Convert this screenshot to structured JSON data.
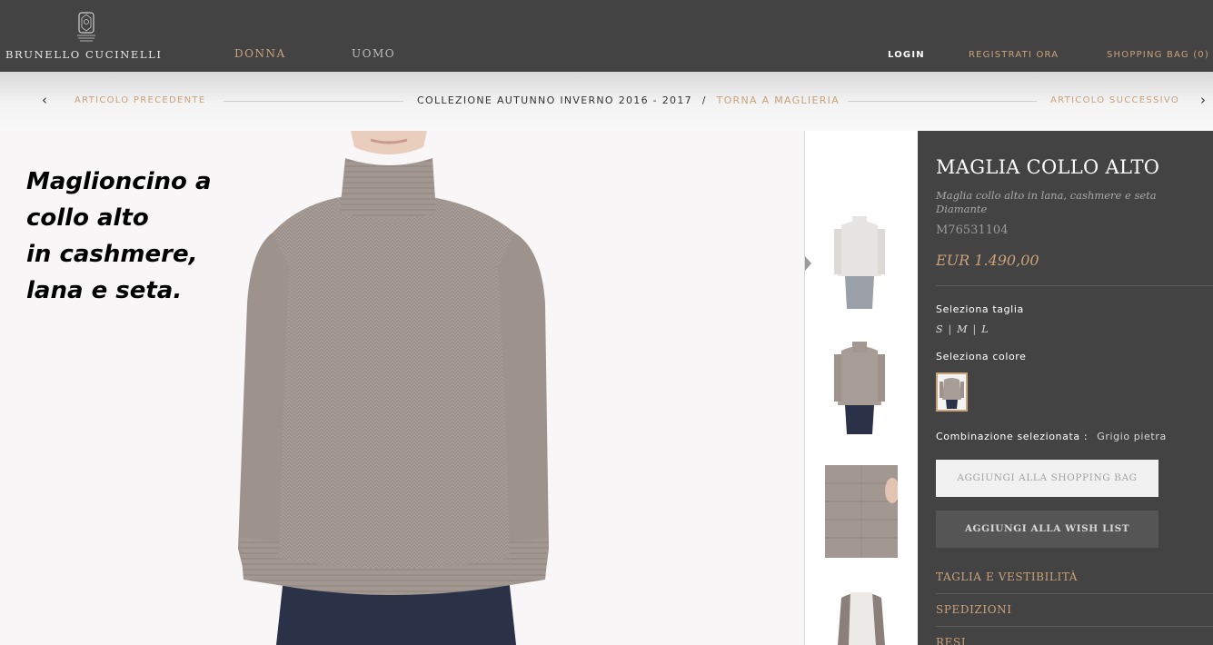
{
  "brand": {
    "name": "BRUNELLO CUCINELLI",
    "emblem_icon": "brand-emblem-icon"
  },
  "nav": {
    "left": [
      {
        "label": "DONNA",
        "active": true
      },
      {
        "label": "UOMO",
        "active": false
      }
    ],
    "right": {
      "login": "LOGIN",
      "register": "REGISTRATI ORA",
      "bag": "SHOPPING BAG (0)"
    }
  },
  "breadcrumb": {
    "prev": "ARTICOLO PRECEDENTE",
    "collection": "COLLEZIONE AUTUNNO INVERNO 2016 - 2017",
    "separator": "/",
    "back": "TORNA A MAGLIERIA",
    "next": "ARTICOLO SUCCESSIVO"
  },
  "overlay": {
    "lines": [
      "Maglioncino a",
      "collo alto",
      "in cashmere,",
      "lana e seta."
    ]
  },
  "product": {
    "title": "MAGLIA COLLO ALTO",
    "description": "Maglia collo alto in lana, cashmere e seta Diamante",
    "code": "M76531104",
    "price": "EUR 1.490,00",
    "size_label": "Seleziona taglia",
    "sizes": [
      "S",
      "M",
      "L"
    ],
    "color_label": "Seleziona colore",
    "combination_label": "Combinazione selezionata :",
    "combination_value": "Grigio pietra",
    "add_to_bag": "AGGIUNGI ALLA SHOPPING BAG",
    "add_to_wishlist": "AGGIUNGI ALLA WISH LIST",
    "accordion": [
      "TAGLIA E VESTIBILITÀ",
      "SPEDIZIONI",
      "RESI"
    ]
  },
  "colors": {
    "topbar": "#434343",
    "accent": "#c9a27a",
    "sweater": "#a89d96",
    "jeans": "#2b3247"
  }
}
